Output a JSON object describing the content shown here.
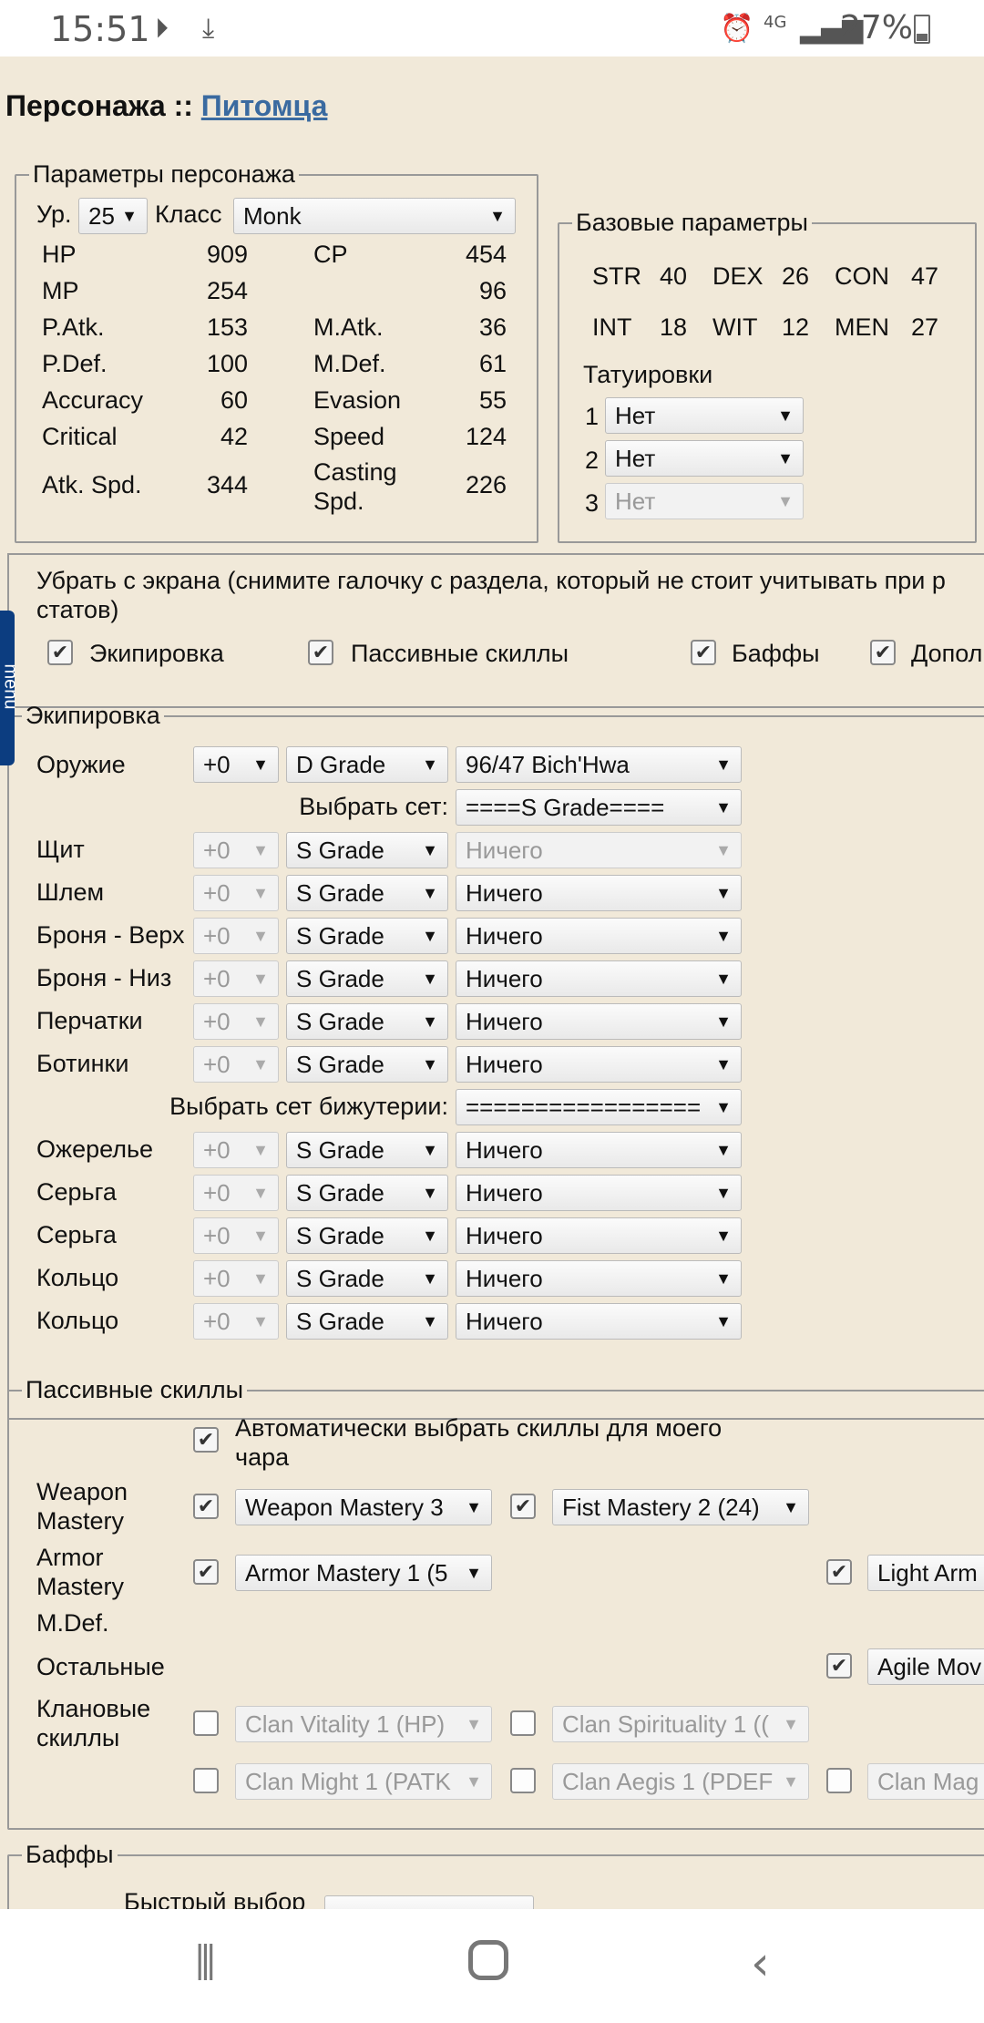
{
  "status": {
    "time": "15:51",
    "network": "4G",
    "battery": "27%"
  },
  "header": {
    "title_prefix": "Персонажа :: ",
    "title_link": "Питомца"
  },
  "char": {
    "legend": "Параметры персонажа",
    "level_label": "Ур.",
    "level": "25",
    "class_label": "Класс",
    "class": "Monk",
    "stats": [
      [
        "HP",
        "909",
        "CP",
        "454"
      ],
      [
        "MP",
        "254",
        "",
        "96"
      ],
      [
        "P.Atk.",
        "153",
        "M.Atk.",
        "36"
      ],
      [
        "P.Def.",
        "100",
        "M.Def.",
        "61"
      ],
      [
        "Accuracy",
        "60",
        "Evasion",
        "55"
      ],
      [
        "Critical",
        "42",
        "Speed",
        "124"
      ],
      [
        "Atk. Spd.",
        "344",
        "Casting Spd.",
        "226"
      ]
    ]
  },
  "base": {
    "legend": "Базовые параметры",
    "row1": [
      "STR",
      "40",
      "DEX",
      "26",
      "CON",
      "47"
    ],
    "row2": [
      "INT",
      "18",
      "WIT",
      "12",
      "MEN",
      "27"
    ],
    "tattoo_label": "Татуировки",
    "tattoos": [
      {
        "n": "1",
        "v": "Нет"
      },
      {
        "n": "2",
        "v": "Нет"
      },
      {
        "n": "3",
        "v": "Нет"
      }
    ]
  },
  "remove": {
    "text_line1": "Убрать с экрана (снимите галочку с раздела, который не стоит учитывать при р",
    "text_line2": "статов)",
    "opts": [
      "Экипировка",
      "Пассивные скиллы",
      "Баффы",
      "Допол"
    ]
  },
  "equip": {
    "legend": "Экипировка",
    "weapon_label": "Оружие",
    "weapon_ench": "+0",
    "weapon_grade": "D Grade",
    "weapon_item": "96/47 Bich'Hwa",
    "set_label": "Выбрать сет:",
    "set_value": "====S Grade====",
    "jewel_set_label": "Выбрать сет бижутерии:",
    "jewel_set_value": "=================",
    "armor": [
      {
        "label": "Щит",
        "ench": "+0",
        "grade": "S Grade",
        "item": "Ничего"
      },
      {
        "label": "Шлем",
        "ench": "+0",
        "grade": "S Grade",
        "item": "Ничего"
      },
      {
        "label": "Броня - Верх",
        "ench": "+0",
        "grade": "S Grade",
        "item": "Ничего"
      },
      {
        "label": "Броня - Низ",
        "ench": "+0",
        "grade": "S Grade",
        "item": "Ничего"
      },
      {
        "label": "Перчатки",
        "ench": "+0",
        "grade": "S Grade",
        "item": "Ничего"
      },
      {
        "label": "Ботинки",
        "ench": "+0",
        "grade": "S Grade",
        "item": "Ничего"
      }
    ],
    "jewels": [
      {
        "label": "Ожерелье",
        "ench": "+0",
        "grade": "S Grade",
        "item": "Ничего"
      },
      {
        "label": "Серьга",
        "ench": "+0",
        "grade": "S Grade",
        "item": "Ничего"
      },
      {
        "label": "Серьга",
        "ench": "+0",
        "grade": "S Grade",
        "item": "Ничего"
      },
      {
        "label": "Кольцо",
        "ench": "+0",
        "grade": "S Grade",
        "item": "Ничего"
      },
      {
        "label": "Кольцо",
        "ench": "+0",
        "grade": "S Grade",
        "item": "Ничего"
      }
    ]
  },
  "passive": {
    "legend": "Пассивные скиллы",
    "auto_line1": "Автоматически выбрать скиллы для моего",
    "auto_line2": "чара",
    "weapon_label1": "Weapon",
    "weapon_label2": "Mastery",
    "weapon_sel": "Weapon Mastery 3",
    "fist_sel": "Fist Mastery 2 (24)",
    "armor_label1": "Armor",
    "armor_label2": "Mastery",
    "armor_sel": "Armor Mastery 1 (5",
    "light_sel": "Light Arm",
    "mdef_label": "M.Def.",
    "other_label": "Остальные",
    "agile_sel": "Agile Mov",
    "clan_label1": "Клановые",
    "clan_label2": "скиллы",
    "clan": [
      "Clan Vitality 1 (HP)",
      "Clan Spirituality 1 ((",
      "Clan Might 1 (PATK",
      "Clan Aegis 1 (PDEF",
      "Clan Mag"
    ]
  },
  "buffs": {
    "legend": "Баффы",
    "quick_label": "Быстрый выбор",
    "quick_value": "============"
  },
  "side_tab": "menu"
}
